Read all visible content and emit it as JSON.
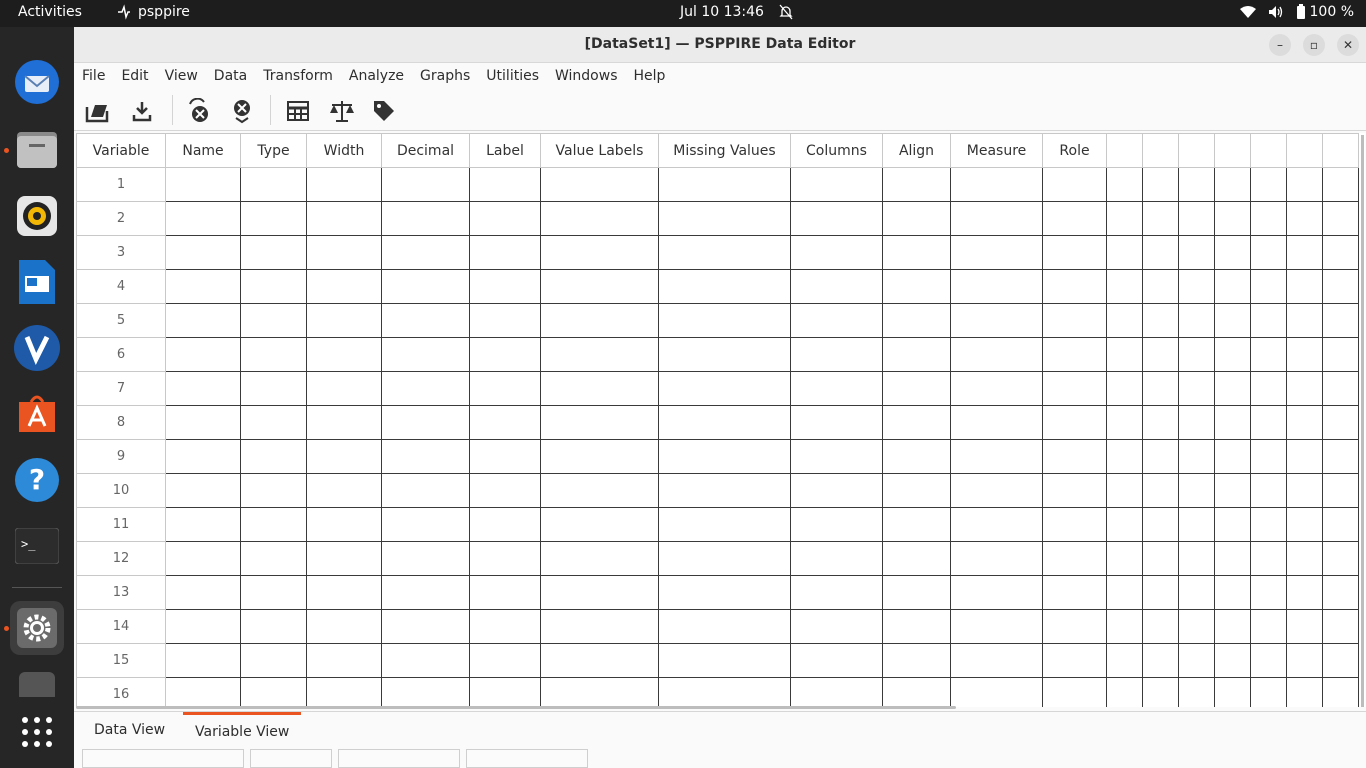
{
  "topbar": {
    "activities": "Activities",
    "app_name": "psppire",
    "clock": "Jul 10  13:46",
    "battery": "100 %"
  },
  "window": {
    "title": "[DataSet1] — PSPPIRE Data Editor"
  },
  "menu": [
    "File",
    "Edit",
    "View",
    "Data",
    "Transform",
    "Analyze",
    "Graphs",
    "Utilities",
    "Windows",
    "Help"
  ],
  "grid": {
    "columns": [
      "Variable",
      "Name",
      "Type",
      "Width",
      "Decimal",
      "Label",
      "Value Labels",
      "Missing Values",
      "Columns",
      "Align",
      "Measure",
      "Role",
      "",
      "",
      "",
      "",
      "",
      "",
      ""
    ],
    "rows": [
      "1",
      "2",
      "3",
      "4",
      "5",
      "6",
      "7",
      "8",
      "9",
      "10",
      "11",
      "12",
      "13",
      "14",
      "15",
      "16"
    ]
  },
  "tabs": {
    "data_view": "Data View",
    "variable_view": "Variable View",
    "selected": "Variable View"
  },
  "colors": {
    "accent": "#e95420",
    "topbar": "#1d1d1d",
    "dock": "#262626"
  }
}
